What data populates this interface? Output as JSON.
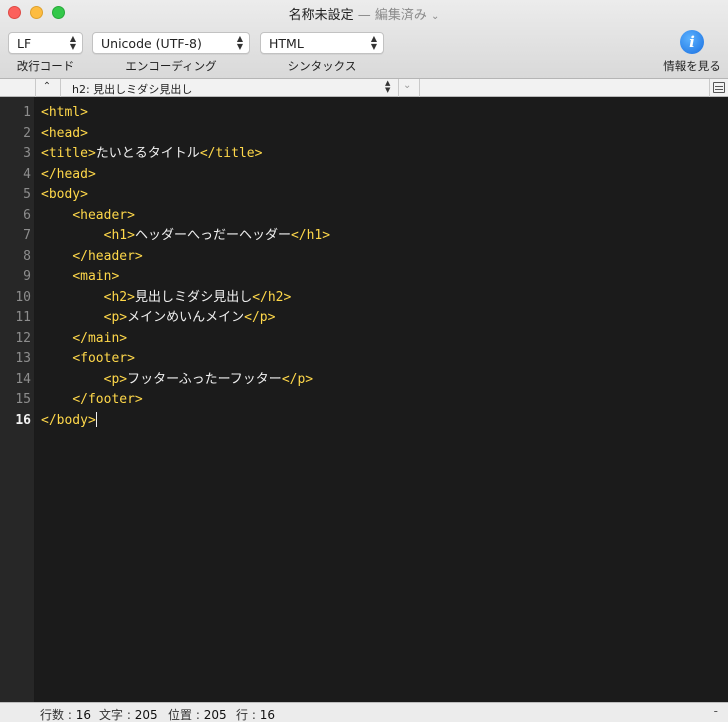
{
  "window": {
    "title": "名称未設定",
    "status": "— 編集済み",
    "status_chevron": "⌄"
  },
  "toolbar": {
    "line_ending": {
      "value": "LF",
      "label": "改行コード"
    },
    "encoding": {
      "value": "Unicode (UTF-8)",
      "label": "エンコーディング"
    },
    "syntax": {
      "value": "HTML",
      "label": "シンタックス"
    },
    "info": {
      "glyph": "i",
      "label": "情報を見る"
    },
    "updown_glyph": "⌃⌄"
  },
  "navbar": {
    "up_glyph": "⌃",
    "current": "h2: 見出しミダシ見出し",
    "chevron_glyph": "⌄"
  },
  "editor": {
    "active_line": 16,
    "lines": [
      {
        "num": "1",
        "indent": "",
        "open": "<html>",
        "text": "",
        "close": ""
      },
      {
        "num": "2",
        "indent": "",
        "open": "<head>",
        "text": "",
        "close": ""
      },
      {
        "num": "3",
        "indent": "",
        "open": "<title>",
        "text": "たいとるタイトル",
        "close": "</title>"
      },
      {
        "num": "4",
        "indent": "",
        "open": "</head>",
        "text": "",
        "close": ""
      },
      {
        "num": "5",
        "indent": "",
        "open": "<body>",
        "text": "",
        "close": ""
      },
      {
        "num": "6",
        "indent": "    ",
        "open": "<header>",
        "text": "",
        "close": ""
      },
      {
        "num": "7",
        "indent": "        ",
        "open": "<h1>",
        "text": "ヘッダーへっだーヘッダー",
        "close": "</h1>"
      },
      {
        "num": "8",
        "indent": "    ",
        "open": "</header>",
        "text": "",
        "close": ""
      },
      {
        "num": "9",
        "indent": "    ",
        "open": "<main>",
        "text": "",
        "close": ""
      },
      {
        "num": "10",
        "indent": "        ",
        "open": "<h2>",
        "text": "見出しミダシ見出し",
        "close": "</h2>"
      },
      {
        "num": "11",
        "indent": "        ",
        "open": "<p>",
        "text": "メインめいんメイン",
        "close": "</p>"
      },
      {
        "num": "12",
        "indent": "    ",
        "open": "</main>",
        "text": "",
        "close": ""
      },
      {
        "num": "13",
        "indent": "    ",
        "open": "<footer>",
        "text": "",
        "close": ""
      },
      {
        "num": "14",
        "indent": "        ",
        "open": "<p>",
        "text": "フッターふったーフッター",
        "close": "</p>"
      },
      {
        "num": "15",
        "indent": "    ",
        "open": "</footer>",
        "text": "",
        "close": ""
      },
      {
        "num": "16",
        "indent": "",
        "open": "</body>",
        "text": "",
        "close": ""
      }
    ]
  },
  "statusbar": {
    "lines": {
      "label": "行数 :",
      "value": "16"
    },
    "chars": {
      "label": "文字 :",
      "value": "205"
    },
    "position": {
      "label": "位置 :",
      "value": "205"
    },
    "row": {
      "label": "行 :",
      "value": "16"
    },
    "right": "-"
  }
}
